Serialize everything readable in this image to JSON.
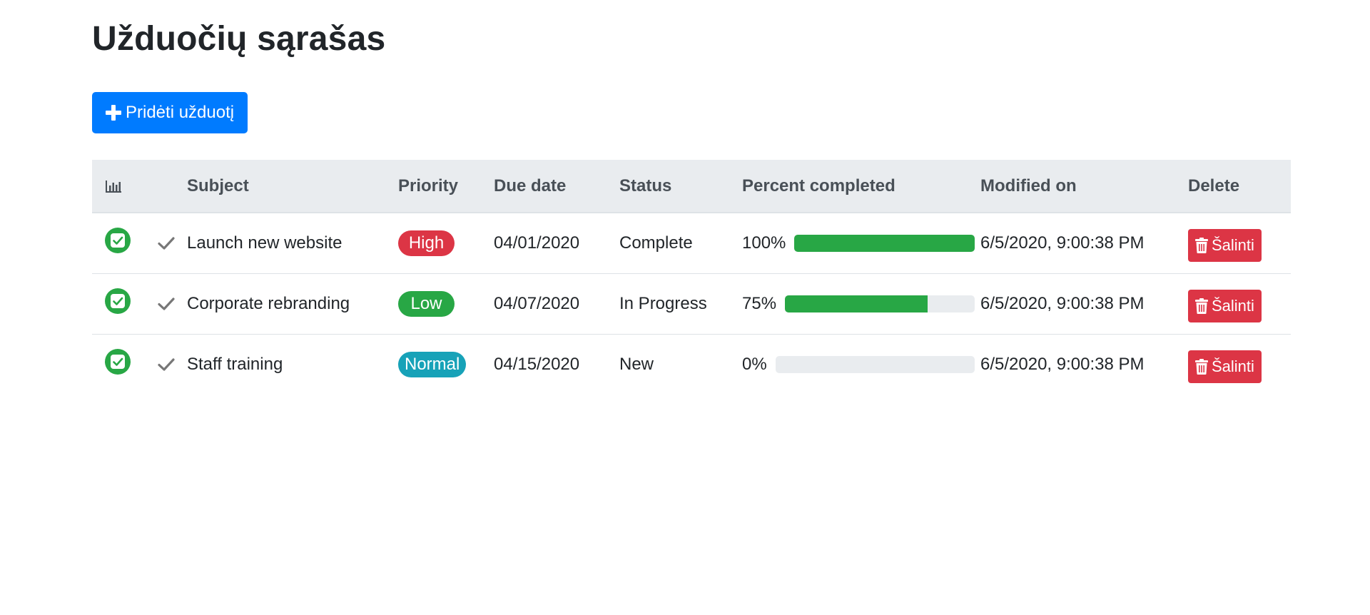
{
  "page": {
    "title": "Užduočių sąrašas",
    "add_button_label": "Pridėti užduotį",
    "add_button_icon": "plus-icon"
  },
  "table": {
    "headers": {
      "stats_icon": "bar-chart-icon",
      "subject": "Subject",
      "priority": "Priority",
      "due_date": "Due date",
      "status": "Status",
      "percent": "Percent completed",
      "modified": "Modified on",
      "delete": "Delete"
    },
    "rows": [
      {
        "subject": "Launch new website",
        "priority": "High",
        "priority_color": "#dc3545",
        "due_date": "04/01/2020",
        "status": "Complete",
        "percent_label": "100%",
        "percent": 100,
        "modified": "6/5/2020, 9:00:38 PM",
        "delete_label": "Šalinti"
      },
      {
        "subject": "Corporate rebranding",
        "priority": "Low",
        "priority_color": "#28a745",
        "due_date": "04/07/2020",
        "status": "In Progress",
        "percent_label": "75%",
        "percent": 75,
        "modified": "6/5/2020, 9:00:38 PM",
        "delete_label": "Šalinti"
      },
      {
        "subject": "Staff training",
        "priority": "Normal",
        "priority_color": "#17a2b8",
        "due_date": "04/15/2020",
        "status": "New",
        "percent_label": "0%",
        "percent": 0,
        "modified": "6/5/2020, 9:00:38 PM",
        "delete_label": "Šalinti"
      }
    ]
  },
  "colors": {
    "primary": "#007bff",
    "success": "#28a745",
    "danger": "#dc3545",
    "info": "#17a2b8",
    "header_bg": "#e9ecef"
  }
}
